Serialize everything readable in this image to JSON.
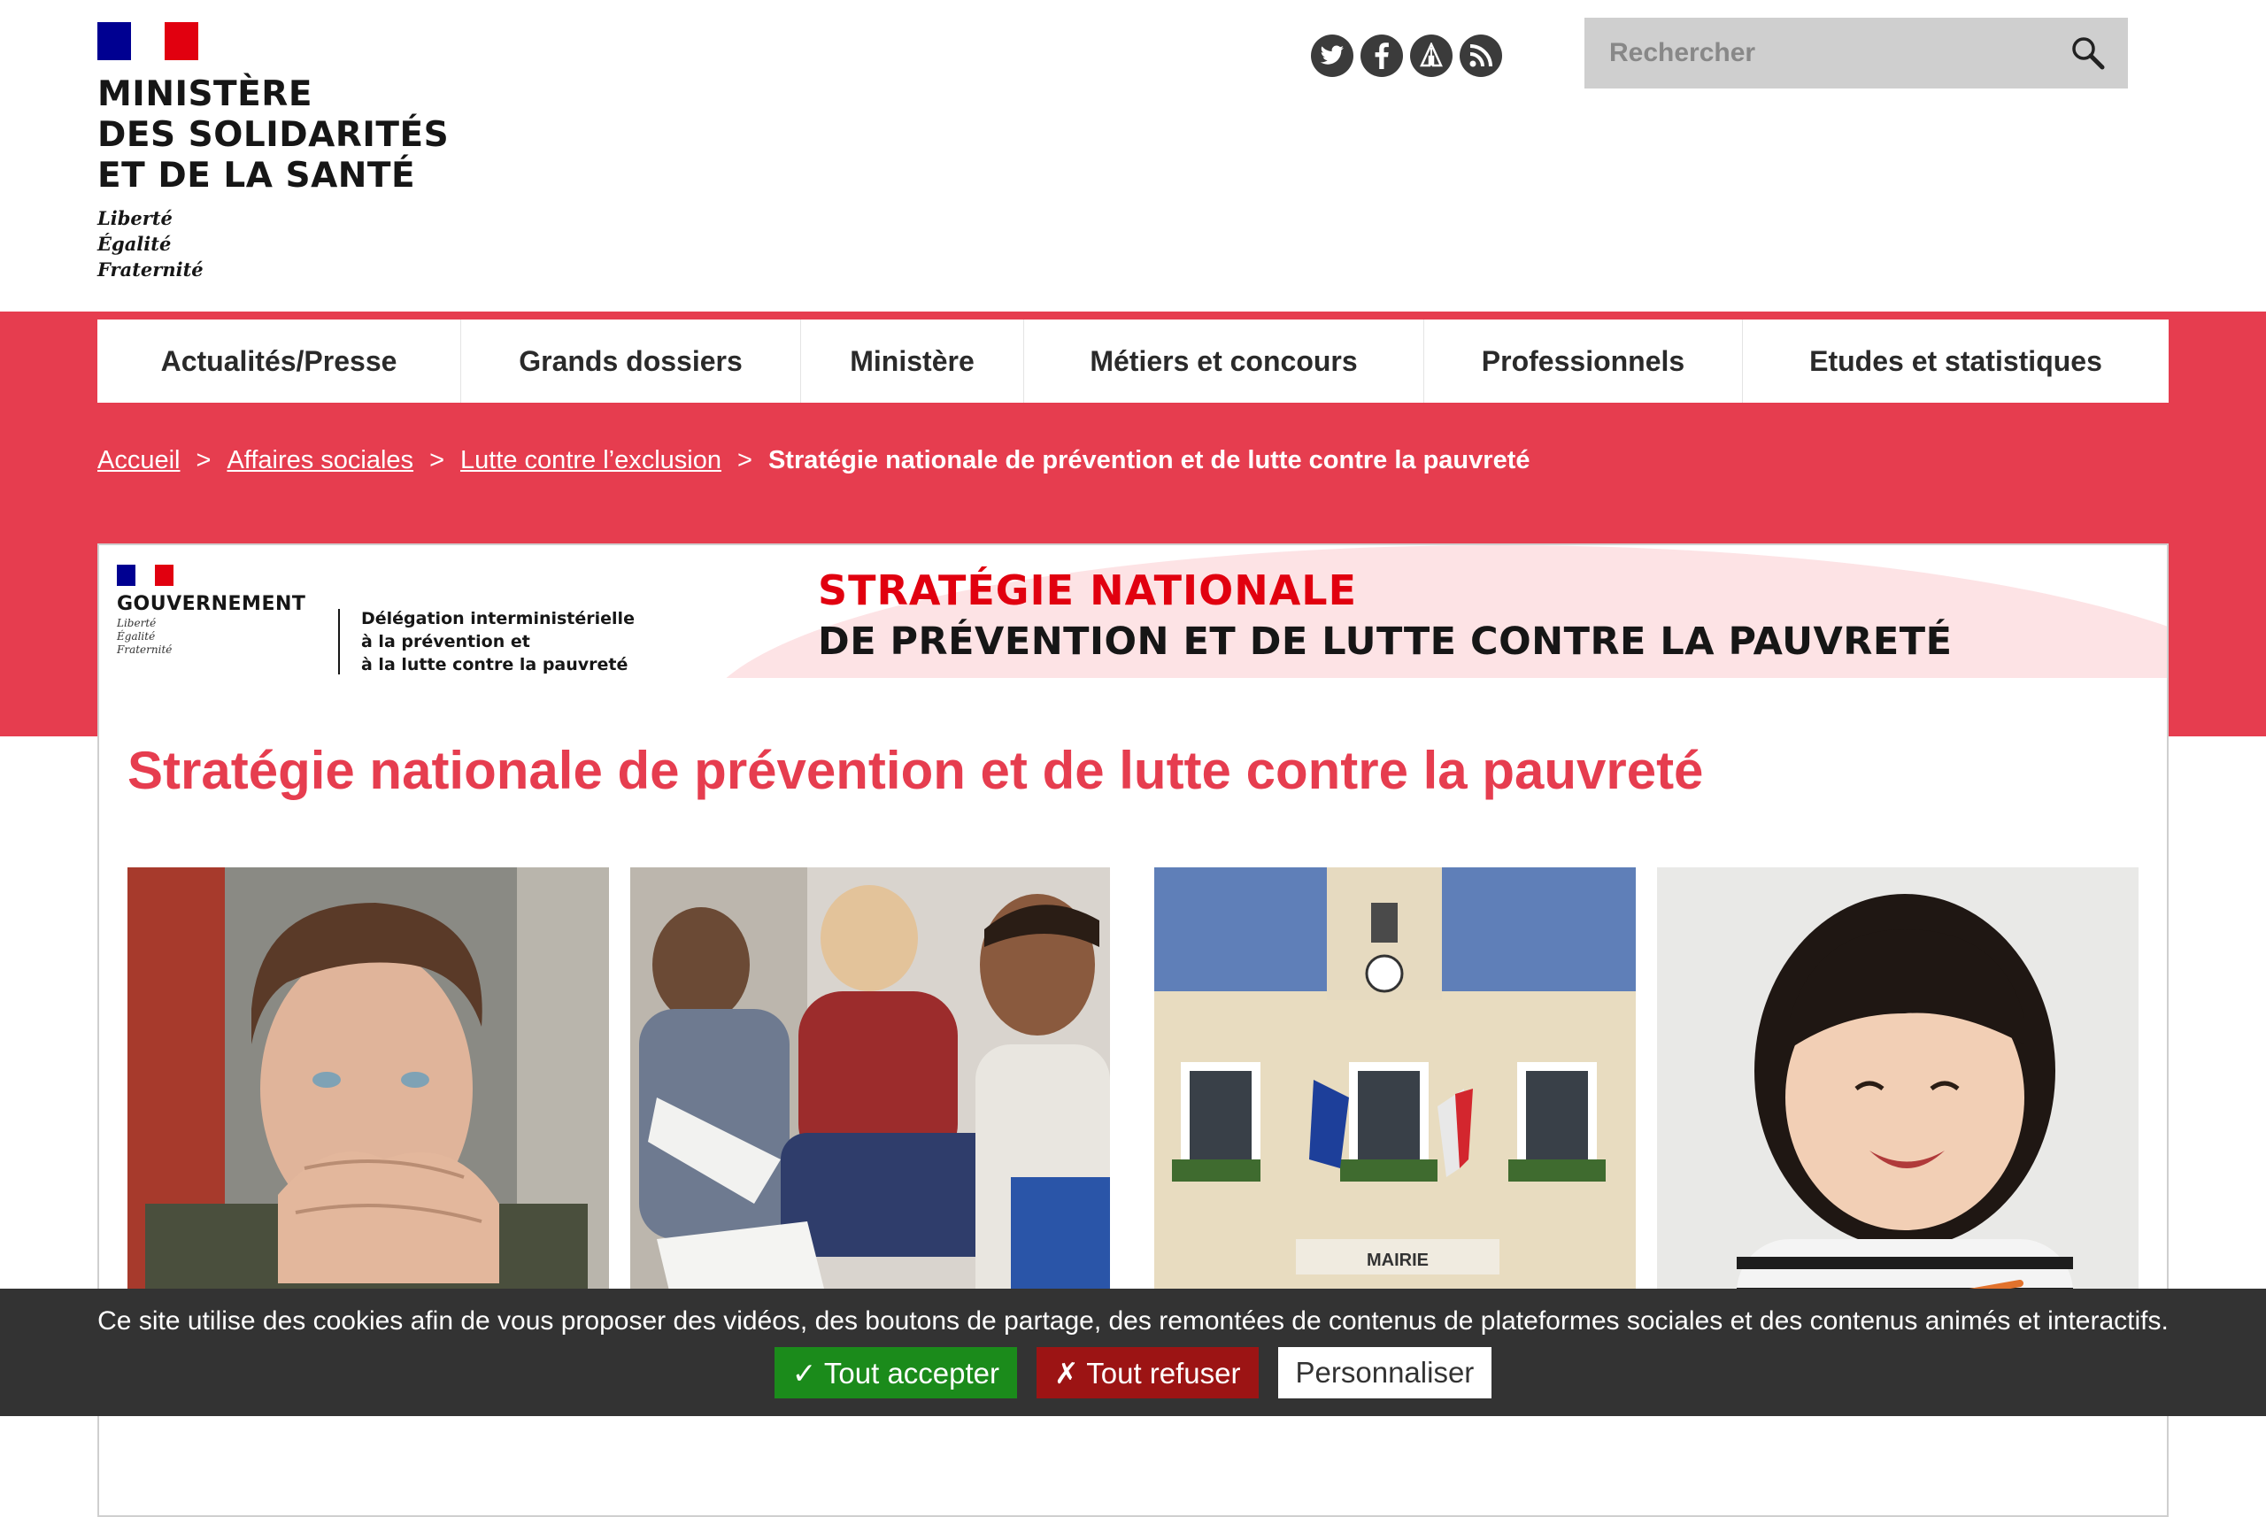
{
  "header": {
    "ministry_name": "MINISTÈRE\nDES SOLIDARITÉS\nET DE LA SANTÉ",
    "motto": "Liberté\nÉgalité\nFraternité",
    "social": [
      "twitter-icon",
      "facebook-icon",
      "pinterest-icon",
      "rss-icon"
    ],
    "search_placeholder": "Rechercher"
  },
  "nav": {
    "items": [
      {
        "label": "Actualités/Presse"
      },
      {
        "label": "Grands dossiers"
      },
      {
        "label": "Ministère"
      },
      {
        "label": "Métiers et concours"
      },
      {
        "label": "Professionnels"
      },
      {
        "label": "Etudes et statistiques"
      }
    ]
  },
  "breadcrumb": {
    "items": [
      {
        "label": "Accueil"
      },
      {
        "label": "Affaires sociales"
      },
      {
        "label": "Lutte contre l’exclusion"
      }
    ],
    "current": "Stratégie nationale de prévention et de lutte contre la pauvreté",
    "separator": ">"
  },
  "banner": {
    "gov_name": "GOUVERNEMENT",
    "gov_motto": "Liberté\nÉgalité\nFraternité",
    "delegation": "Délégation interministérielle\nà la prévention et\nà la lutte contre la pauvreté",
    "title_line1": "STRATÉGIE NATIONALE",
    "title_line2": "DE PRÉVENTION ET DE LUTTE CONTRE LA PAUVRETÉ"
  },
  "page_title": "Stratégie nationale de prévention et de lutte contre la pauvreté",
  "photos": {
    "town_hall_sign": "MAIRIE"
  },
  "cookie": {
    "message": "Ce site utilise des cookies afin de vous proposer des vidéos, des boutons de partage, des remontées de contenus de plateformes sociales et des contenus animés et interactifs.",
    "accept": "✓ Tout accepter",
    "refuse": "✗ Tout refuser",
    "customize": "Personnaliser"
  },
  "colors": {
    "accent_red": "#e63d4f",
    "accept_green": "#1b8b1b",
    "refuse_red": "#9c1414",
    "cookie_bg": "#333333"
  }
}
